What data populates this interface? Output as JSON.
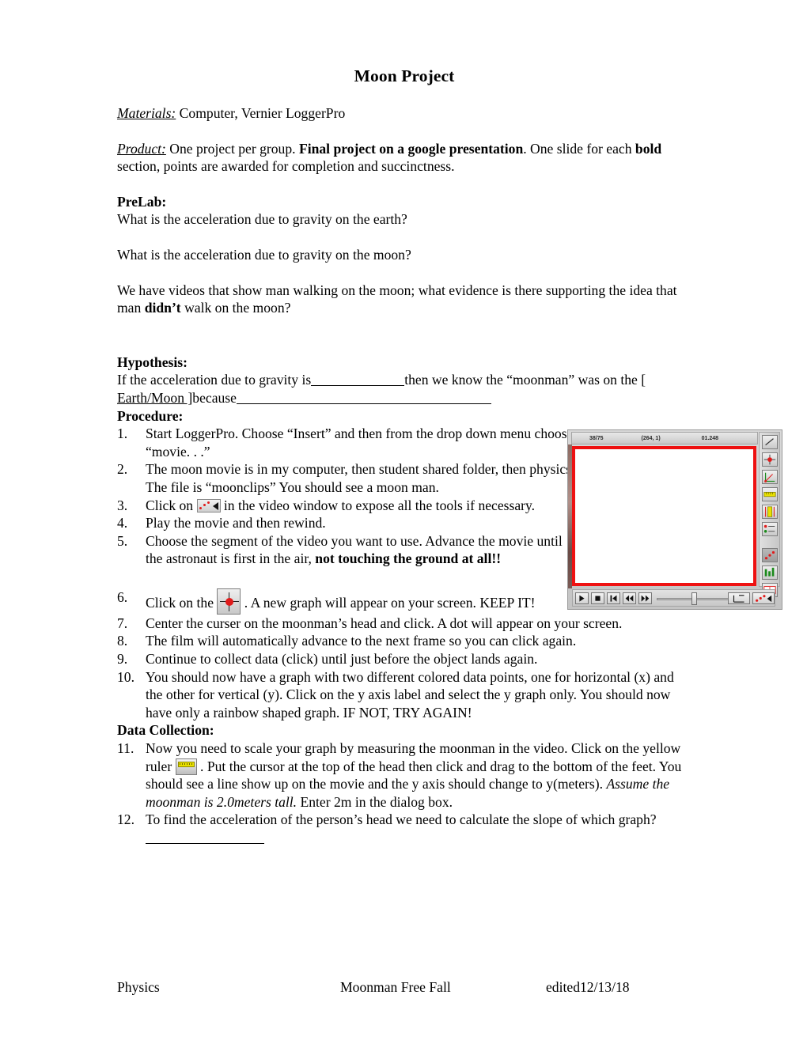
{
  "document": {
    "title": "Moon Project",
    "materials_label": "Materials:",
    "materials_text": "  Computer, Vernier LoggerPro",
    "product_label": "Product:",
    "product_text_1": " One project per group.  ",
    "product_bold": "Final project on a google presentation",
    "product_text_2": ". One slide for each ",
    "product_bold_2": "bold",
    "product_text_3": " section, points are awarded for completion and succinctness.",
    "prelab_heading": "PreLab:",
    "prelab_q1": "What is the acceleration due to gravity on the earth?",
    "prelab_q2": "What is the acceleration due to gravity on the moon?",
    "prelab_q3_a": "We have videos that show man walking on the moon; what evidence is there supporting the idea that man ",
    "prelab_q3_bold": "didn’t",
    "prelab_q3_b": " walk on the moon?",
    "hypothesis_heading": "Hypothesis:",
    "hypothesis_a": "If the acceleration due to gravity is",
    "hypothesis_b": "then we know the “moonman” was on the ",
    "hypothesis_choice": "[ Earth/Moon ]",
    "hypothesis_c": "because",
    "procedure_heading": "Procedure:",
    "data_collection_heading": "Data Collection:"
  },
  "procedure": {
    "items": [
      {
        "num": "1.",
        "text": "Start LoggerPro.  Choose “Insert”  and then from the drop down menu choose “movie. . .”"
      },
      {
        "num": "2.",
        "text": "The moon movie is in my computer, then student shared folder, then physics.  The file is “moonclips”  You should see a moon man."
      },
      {
        "num": "3.",
        "pre": "Click on ",
        "post": " in the video window to expose all the tools if necessary.",
        "icon": "toggle-tools-icon"
      },
      {
        "num": "4.",
        "text": "Play the movie and then rewind."
      },
      {
        "num": "5.",
        "pre": "Choose the segment of the video you want to use. Advance the movie until the astronaut is first in the air, ",
        "bold": "not touching the ground at all!!"
      },
      {
        "num": "6.",
        "pre": "Click on the ",
        "post": " .  A new graph will appear on your screen. KEEP IT!",
        "icon": "add-point-target-icon"
      },
      {
        "num": "7.",
        "text": "Center the curser on the moonman’s head and click.  A dot will appear on your screen."
      },
      {
        "num": "8.",
        "text": "The film will automatically advance to the next frame so you can click again."
      },
      {
        "num": "9.",
        "text": "Continue to collect data (click) until just before the object lands again."
      },
      {
        "num": "10.",
        "text": "You should now have a graph with two different colored data points, one for horizontal (x) and the other for vertical (y).  Click on the y axis label and select the y graph only.  You should now have only a rainbow shaped graph.  IF NOT, TRY AGAIN!"
      },
      {
        "num": "11.",
        "pre": "Now you need to scale your graph by measuring the moonman in the video.  Click on the yellow ruler ",
        "mid": " .  Put the cursor at the top of the head then click and drag to the bottom of the feet.  You should see a line show up on the movie and the y axis should change to y(meters).  ",
        "italic": "Assume the moonman is 2.0meters tall.",
        "post": "  Enter 2m in the dialog box.",
        "icon": "yellow-ruler-icon"
      },
      {
        "num": "12.",
        "text": "To find the acceleration of the person’s head we need to calculate the slope of which graph?"
      }
    ]
  },
  "video_window": {
    "status": {
      "frame": "38/75",
      "coordinates": "(264, 1)",
      "time": "01.248"
    },
    "toolbar_tools": [
      "line-tool-icon",
      "add-point-target-icon",
      "set-origin-icon",
      "yellow-ruler-icon",
      "vertical-scale-icon",
      "point-series-icon",
      "show-points-icon",
      "graph-overlay-icon",
      "data-table-icon"
    ],
    "controls": [
      "play-icon",
      "stop-icon",
      "rewind-to-start-icon",
      "step-back-icon",
      "step-forward-icon",
      "slider-icon",
      "axes-tool-icon",
      "toggle-tools-icon"
    ],
    "border_color": "#ee1111"
  },
  "footer": {
    "left": "Physics",
    "middle": "Moonman Free Fall",
    "right": "edited12/13/18"
  }
}
